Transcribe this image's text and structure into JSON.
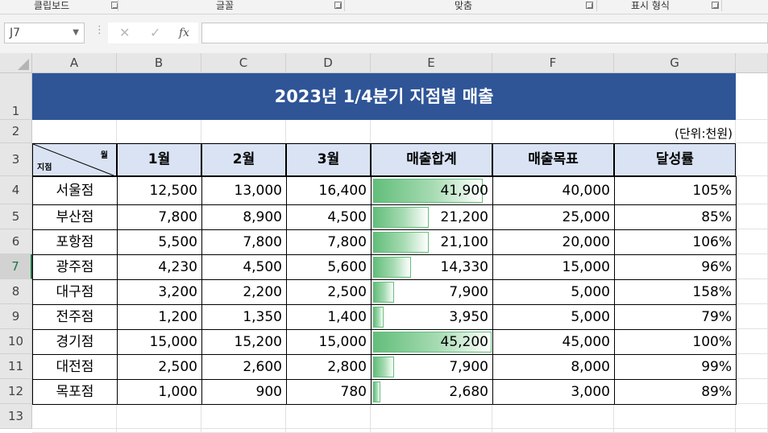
{
  "ribbon": {
    "groups": [
      {
        "label": "클립보드"
      },
      {
        "label": "글꼴"
      },
      {
        "label": "맞춤"
      },
      {
        "label": "표시 형식"
      }
    ]
  },
  "formula_bar": {
    "name_box": "J7",
    "cancel_icon": "✕",
    "enter_icon": "✓",
    "fx_label": "fx",
    "formula": ""
  },
  "columns": [
    "A",
    "B",
    "C",
    "D",
    "E",
    "F",
    "G"
  ],
  "rows": [
    "1",
    "2",
    "3",
    "4",
    "5",
    "6",
    "7",
    "8",
    "9",
    "10",
    "11",
    "12",
    "13"
  ],
  "active_row": "7",
  "sheet": {
    "title": "2023년 1/4분기 지점별 매출",
    "unit": "(단위:천원)",
    "diag_month": "월",
    "diag_branch": "지점",
    "headers": [
      "1월",
      "2월",
      "3월",
      "매출합계",
      "매출목표",
      "달성률"
    ],
    "rows": [
      {
        "branch": "서울점",
        "m1": "12,500",
        "m2": "13,000",
        "m3": "16,400",
        "total": "41,900",
        "target": "40,000",
        "rate": "105%",
        "total_value": 41900
      },
      {
        "branch": "부산점",
        "m1": "7,800",
        "m2": "8,900",
        "m3": "4,500",
        "total": "21,200",
        "target": "25,000",
        "rate": "85%",
        "total_value": 21200
      },
      {
        "branch": "포항점",
        "m1": "5,500",
        "m2": "7,800",
        "m3": "7,800",
        "total": "21,100",
        "target": "20,000",
        "rate": "106%",
        "total_value": 21100
      },
      {
        "branch": "광주점",
        "m1": "4,230",
        "m2": "4,500",
        "m3": "5,600",
        "total": "14,330",
        "target": "15,000",
        "rate": "96%",
        "total_value": 14330
      },
      {
        "branch": "대구점",
        "m1": "3,200",
        "m2": "2,200",
        "m3": "2,500",
        "total": "7,900",
        "target": "5,000",
        "rate": "158%",
        "total_value": 7900
      },
      {
        "branch": "전주점",
        "m1": "1,200",
        "m2": "1,350",
        "m3": "1,400",
        "total": "3,950",
        "target": "5,000",
        "rate": "79%",
        "total_value": 3950
      },
      {
        "branch": "경기점",
        "m1": "15,000",
        "m2": "15,200",
        "m3": "15,000",
        "total": "45,200",
        "target": "45,000",
        "rate": "100%",
        "total_value": 45200
      },
      {
        "branch": "대전점",
        "m1": "2,500",
        "m2": "2,600",
        "m3": "2,800",
        "total": "7,900",
        "target": "8,000",
        "rate": "99%",
        "total_value": 7900
      },
      {
        "branch": "목포점",
        "m1": "1,000",
        "m2": "900",
        "m3": "780",
        "total": "2,680",
        "target": "3,000",
        "rate": "89%",
        "total_value": 2680
      }
    ],
    "data_bar_max": 45200,
    "data_bar_color": "#63be7b",
    "title_fill": "#2f5597",
    "header_fill": "#dae3f3"
  }
}
